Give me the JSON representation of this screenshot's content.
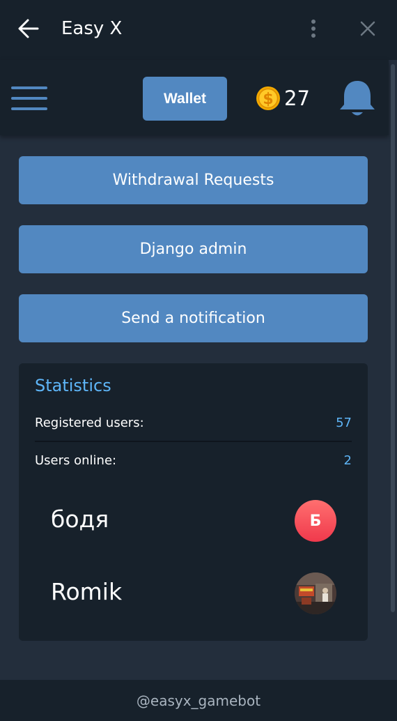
{
  "window": {
    "title": "Easy X",
    "back_icon": "arrow-left-icon",
    "menu_icon": "more-vertical-icon",
    "close_icon": "close-icon"
  },
  "header": {
    "menu_icon": "hamburger-menu-icon",
    "wallet_label": "Wallet",
    "coin_icon": "dollar-coin-icon",
    "balance": "27",
    "bell_icon": "bell-icon"
  },
  "actions": [
    {
      "label": "Withdrawal Requests"
    },
    {
      "label": "Django admin"
    },
    {
      "label": "Send a notification"
    }
  ],
  "statistics": {
    "title": "Statistics",
    "rows": [
      {
        "label": "Registered users:",
        "value": "57"
      },
      {
        "label": "Users online:",
        "value": "2"
      }
    ],
    "online_users": [
      {
        "name": "бодя",
        "avatar_letter": "Б"
      },
      {
        "name": "Romik",
        "avatar_letter": ""
      }
    ]
  },
  "footer": {
    "text": "@easyx_gamebot"
  },
  "colors": {
    "background": "#232e3c",
    "panel": "#17212b",
    "accent": "#5288c1",
    "link": "#5eb5f7"
  }
}
